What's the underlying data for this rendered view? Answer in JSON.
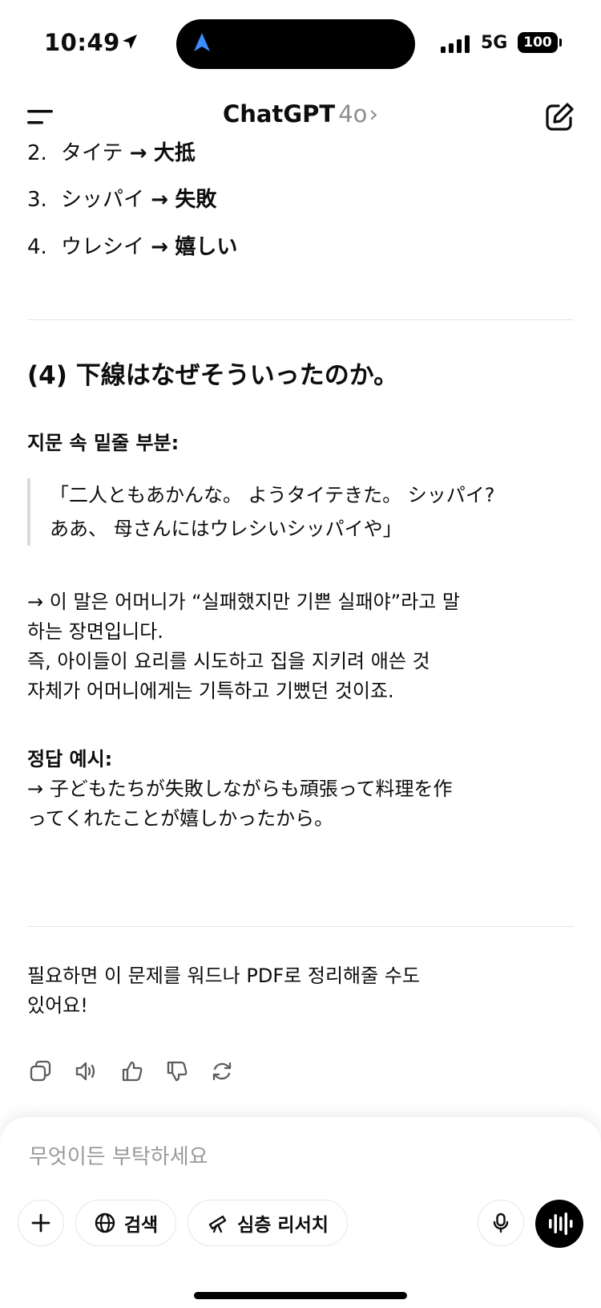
{
  "status_bar": {
    "time": "10:49",
    "network": "5G",
    "battery": "100"
  },
  "header": {
    "app_name": "ChatGPT",
    "model": "4o",
    "chevron": "›"
  },
  "list": [
    {
      "num": "2.",
      "word": "タイテ",
      "arrow": "→",
      "answer": "大抵"
    },
    {
      "num": "3.",
      "word": "シッパイ",
      "arrow": "→",
      "answer": "失敗"
    },
    {
      "num": "4.",
      "word": "ウレシイ",
      "arrow": "→",
      "answer": "嬉しい"
    }
  ],
  "question": {
    "label": "(4)",
    "text": "下線はなぜそういったのか。"
  },
  "passage": {
    "title": "지문 속 밑줄 부분:",
    "quote_lines": [
      "「二人ともあかんな。 ようタイテきた。 シッパイ?",
      "ああ、 母さんにはウレシいシッパイや」"
    ]
  },
  "explanation_lines": [
    "→ 이 말은 어머니가 “실패했지만 기쁜 실패야”라고 말",
    "하는 장면입니다.",
    "즉, 아이들이 요리를 시도하고 집을 지키려 애쓴 것",
    "자체가 어머니에게는 기특하고 기뻤던 것이죠."
  ],
  "answer": {
    "title": "정답 예시:",
    "lines": [
      "→ 子どもたちが失敗しながらも頑張って料理を作",
      "ってくれたことが嬉しかったから。"
    ]
  },
  "closing_lines": [
    "필요하면 이 문제를 워드나 PDF로 정리해줄 수도",
    "있어요!"
  ],
  "message_actions": [
    "copy-icon",
    "speaker-icon",
    "thumbs-up-icon",
    "thumbs-down-icon",
    "regenerate-icon"
  ],
  "composer": {
    "placeholder": "무엇이든 부탁하세요",
    "search_label": "검색",
    "deep_research_label": "심층 리서치"
  }
}
